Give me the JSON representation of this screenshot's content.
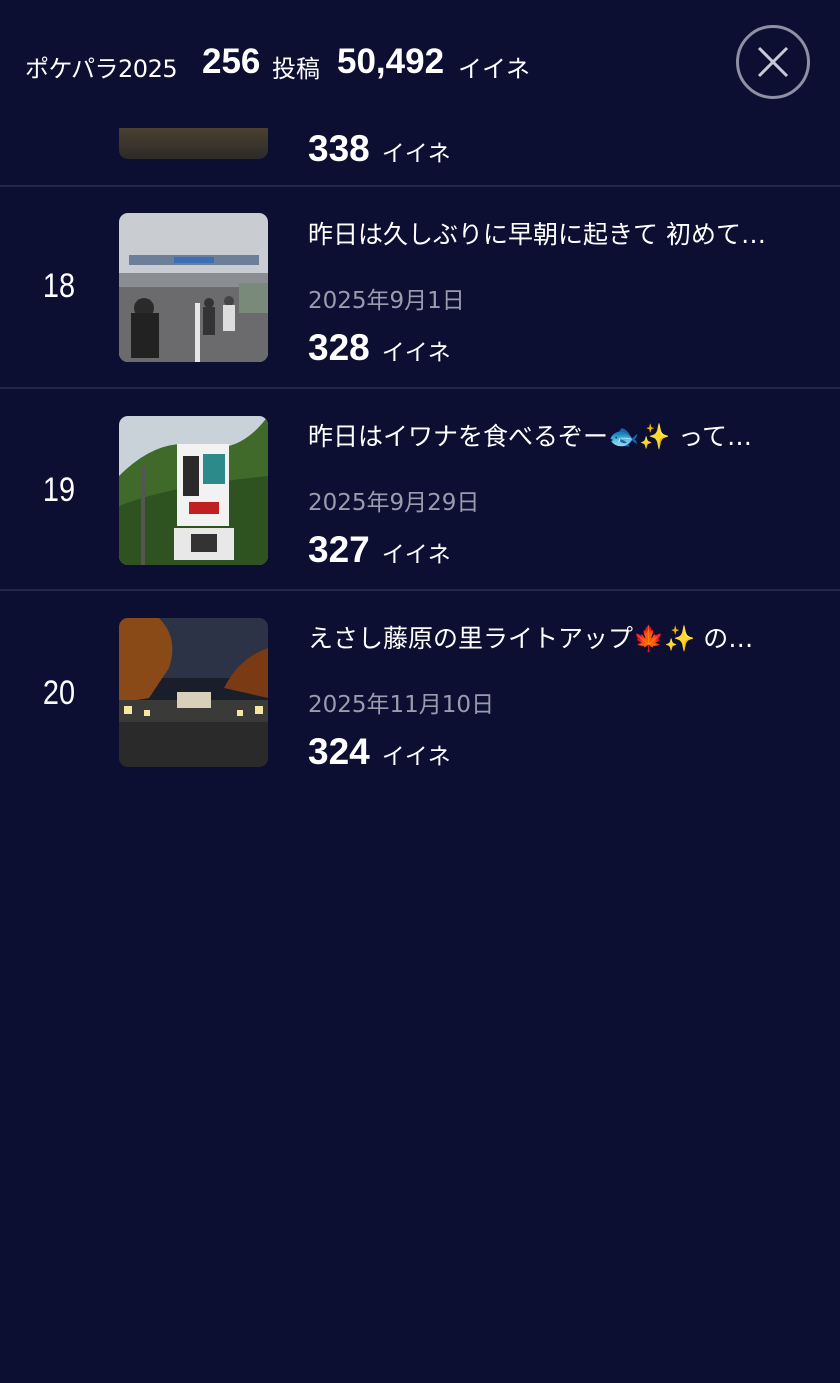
{
  "header": {
    "app_name": "ポケパラ2025",
    "post_count": "256",
    "post_unit": "投稿",
    "like_total": "50,492",
    "like_unit": "イイネ"
  },
  "items": [
    {
      "likes": "338",
      "like_unit": "イイネ"
    },
    {
      "rank": "18",
      "title": "昨日は久しぶりに早朝に起きて 初めて…",
      "date": "2025年9月1日",
      "likes": "328",
      "like_unit": "イイネ",
      "thumb": "event-crowd-road-photo"
    },
    {
      "rank": "19",
      "title": "昨日はイワナを食べるぞー🐟✨ って…",
      "date": "2025年9月29日",
      "likes": "327",
      "like_unit": "イイネ",
      "thumb": "restaurant-sign-photo"
    },
    {
      "rank": "20",
      "title": "えさし藤原の里ライトアップ🍁✨ の…",
      "date": "2025年11月10日",
      "likes": "324",
      "like_unit": "イイネ",
      "thumb": "light-up-night-photo"
    }
  ]
}
